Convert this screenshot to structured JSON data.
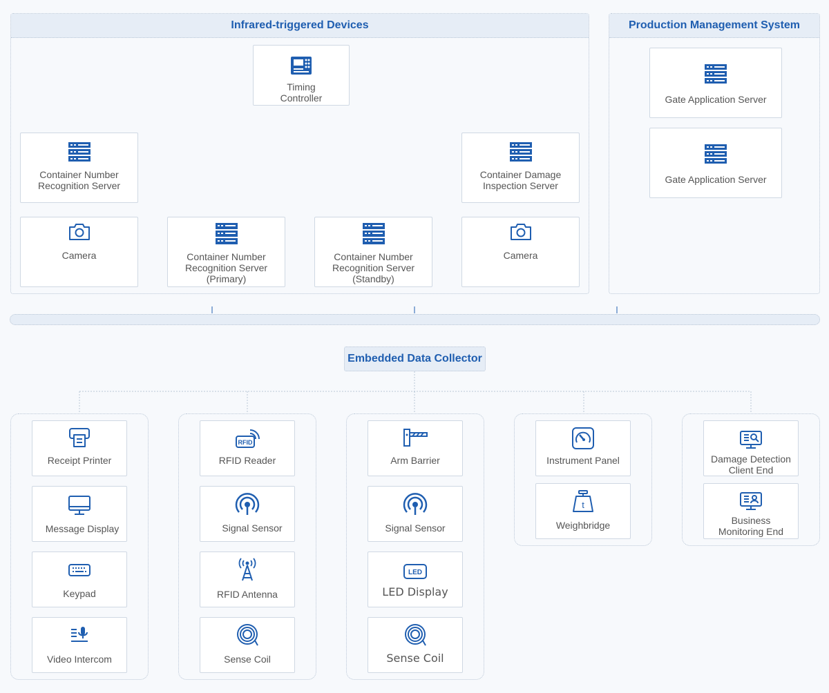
{
  "top_groups": {
    "infrared": {
      "title": "Infrared-triggered Devices"
    },
    "production": {
      "title": "Production Management System"
    }
  },
  "nodes": {
    "timing_controller": {
      "label": "Timing\nController",
      "icon": "controller-icon"
    },
    "cnr_server_left": {
      "label": "Container Number\nRecognition Server",
      "icon": "server-icon"
    },
    "cdi_server": {
      "label": "Container Damage\nInspection Server",
      "icon": "server-icon"
    },
    "camera_left": {
      "label": "Camera",
      "icon": "camera-icon"
    },
    "cnr_primary": {
      "label": "Container Number\nRecognition Server\n(Primary)",
      "icon": "server-icon"
    },
    "cnr_standby": {
      "label": "Container Number\nRecognition Server\n(Standby)",
      "icon": "server-icon"
    },
    "camera_right": {
      "label": "Camera",
      "icon": "camera-icon"
    },
    "gate_server_1": {
      "label": "Gate Application Server",
      "icon": "server-icon"
    },
    "gate_server_2": {
      "label": "Gate Application Server",
      "icon": "server-icon"
    }
  },
  "collector": {
    "label": "Embedded Data Collector"
  },
  "bottom_groups": [
    {
      "items": [
        {
          "label": "Receipt Printer",
          "icon": "printer-icon"
        },
        {
          "label": "Message Display",
          "icon": "monitor-icon"
        },
        {
          "label": "Keypad",
          "icon": "keypad-icon"
        },
        {
          "label": "Video Intercom",
          "icon": "intercom-icon"
        }
      ]
    },
    {
      "items": [
        {
          "label": "RFID Reader",
          "icon": "rfid-reader-icon"
        },
        {
          "label": "Signal Sensor",
          "icon": "signal-sensor-icon"
        },
        {
          "label": "RFID Antenna",
          "icon": "antenna-icon"
        },
        {
          "label": "Sense Coil",
          "icon": "coil-icon"
        }
      ]
    },
    {
      "items": [
        {
          "label": "Arm Barrier",
          "icon": "barrier-icon"
        },
        {
          "label": "Signal Sensor",
          "icon": "signal-sensor-icon"
        },
        {
          "label": "LED Display",
          "icon": "led-icon",
          "icon_text": "LED"
        },
        {
          "label": "Sense Coil",
          "icon": "coil-icon"
        }
      ]
    },
    {
      "items": [
        {
          "label": "Instrument Panel",
          "icon": "gauge-icon"
        },
        {
          "label": "Weighbridge",
          "icon": "weight-icon",
          "icon_text": "t"
        }
      ]
    },
    {
      "items": [
        {
          "label": "Damage Detection\nClient End",
          "icon": "inspection-monitor-icon"
        },
        {
          "label": "Business\nMonitoring End",
          "icon": "user-monitor-icon"
        }
      ]
    }
  ],
  "rfid_icon_text": "RFID",
  "colors": {
    "accent": "#1f5eb0",
    "border": "#cfd8e3",
    "header_bg": "#e6edf6",
    "line": "#b9c6d6"
  }
}
